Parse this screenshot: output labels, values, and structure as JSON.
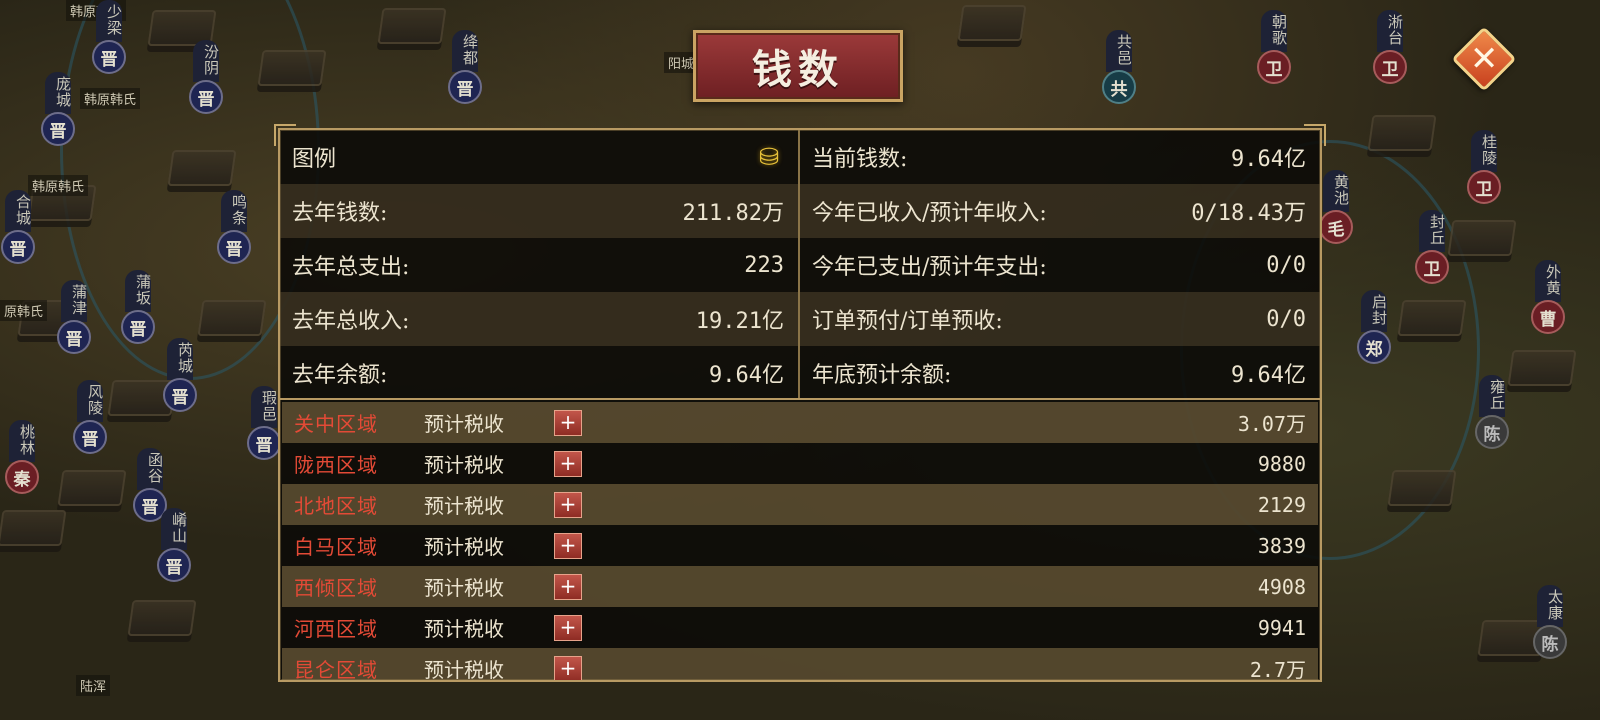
{
  "title": "钱数",
  "close_label": "✕",
  "legend": {
    "label": "图例",
    "icon": "gold-ingot-icon"
  },
  "left_stats": [
    {
      "label": "去年钱数:",
      "value": "211.82万"
    },
    {
      "label": "去年总支出:",
      "value": "223"
    },
    {
      "label": "去年总收入:",
      "value": "19.21亿"
    },
    {
      "label": "去年余额:",
      "value": "9.64亿"
    }
  ],
  "right_stats": [
    {
      "label": "当前钱数:",
      "value": "9.64亿"
    },
    {
      "label": "今年已收入/预计年收入:",
      "value": "0/18.43万"
    },
    {
      "label": "今年已支出/预计年支出:",
      "value": "0/0"
    },
    {
      "label": "订单预付/订单预收:",
      "value": "0/0"
    },
    {
      "label": "年底预计余额:",
      "value": "9.64亿"
    }
  ],
  "regions": [
    {
      "name": "关中区域",
      "tax_label": "预计税收",
      "value": "3.07万"
    },
    {
      "name": "陇西区域",
      "tax_label": "预计税收",
      "value": "9880"
    },
    {
      "name": "北地区域",
      "tax_label": "预计税收",
      "value": "2129"
    },
    {
      "name": "白马区域",
      "tax_label": "预计税收",
      "value": "3839"
    },
    {
      "name": "西倾区域",
      "tax_label": "预计税收",
      "value": "4908"
    },
    {
      "name": "河西区域",
      "tax_label": "预计税收",
      "value": "9941"
    },
    {
      "name": "昆仑区域",
      "tax_label": "预计税收",
      "value": "2.7万"
    }
  ],
  "map": {
    "markers": [
      {
        "name": "少梁",
        "state": "晋"
      },
      {
        "name": "庞城",
        "state": "晋"
      },
      {
        "name": "汾阴",
        "state": "晋"
      },
      {
        "name": "绛都",
        "state": "晋"
      },
      {
        "name": "鸣条",
        "state": "晋"
      },
      {
        "name": "合城",
        "state": "晋"
      },
      {
        "name": "蒲津",
        "state": "晋"
      },
      {
        "name": "蒲坂",
        "state": "晋"
      },
      {
        "name": "芮城",
        "state": "晋"
      },
      {
        "name": "风陵",
        "state": "晋"
      },
      {
        "name": "桃林",
        "state": "秦"
      },
      {
        "name": "函谷",
        "state": "晋"
      },
      {
        "name": "崤山",
        "state": "晋"
      },
      {
        "name": "瑕邑",
        "state": "晋"
      },
      {
        "name": "共邑",
        "state": "共"
      },
      {
        "name": "朝歌",
        "state": "卫"
      },
      {
        "name": "淅台",
        "state": "卫"
      },
      {
        "name": "桂陵",
        "state": "卫"
      },
      {
        "name": "封丘",
        "state": "卫"
      },
      {
        "name": "启封",
        "state": "郑"
      },
      {
        "name": "外黄",
        "state": "曹"
      },
      {
        "name": "雍丘",
        "state": "陈"
      },
      {
        "name": "太康",
        "state": "陈"
      },
      {
        "name": "黄池",
        "state": "毛"
      }
    ],
    "labels": [
      "韩原韩氏",
      "韩原韩氏",
      "韩原韩氏",
      "原韩氏",
      "阳城",
      "陆浑"
    ]
  }
}
